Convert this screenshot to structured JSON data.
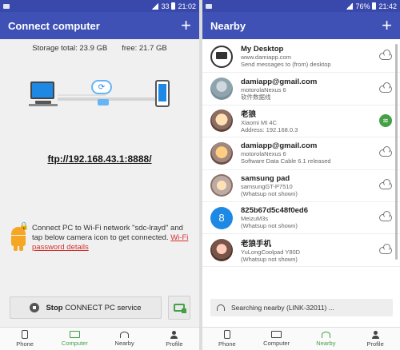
{
  "left": {
    "status": {
      "signal": "33",
      "time": "21:02"
    },
    "title": "Connect computer",
    "storage_total": "Storage total: 23.9 GB",
    "storage_free": "free: 21.7 GB",
    "ftp_address": "ftp://192.168.43.1:8888/",
    "instruction": "Connect PC to Wi-Fi network \"sdc-lrayd\" and tap below camera icon to get connected.",
    "instruction_link": "Wi-Fi password details",
    "stop_prefix": "Stop",
    "stop_label": "CONNECT PC service",
    "nav": [
      {
        "label": "Phone",
        "icon": "phone-icon"
      },
      {
        "label": "Computer",
        "icon": "computer-icon",
        "active": true
      },
      {
        "label": "Nearby",
        "icon": "nearby-icon"
      },
      {
        "label": "Profile",
        "icon": "profile-icon"
      }
    ]
  },
  "right": {
    "status": {
      "battery": "76%",
      "time": "21:42"
    },
    "title": "Nearby",
    "devices": [
      {
        "name": "My Desktop",
        "sub1": "www.damiapp.com",
        "sub2": "Send messages to (from) desktop",
        "avatar": "desktop",
        "status": "cloud"
      },
      {
        "name": "damiapp@gmail.com",
        "sub1": "motorolaNexus 6",
        "sub2": "软件数据线",
        "avatar": "photo1",
        "status": "cloud"
      },
      {
        "name": "老狼",
        "sub1": "Xiaomi MI 4C",
        "sub2": "Address: 192.168.0.3",
        "avatar": "photo2",
        "status": "wifi"
      },
      {
        "name": "damiapp@gmail.com",
        "sub1": "motorolaNexus 6",
        "sub2": "Software Data Cable 6.1 released",
        "avatar": "photo3",
        "status": "cloud"
      },
      {
        "name": "samsung pad",
        "sub1": "samsungGT-P7510",
        "sub2": "(Whatsup not shown)",
        "avatar": "photo4",
        "status": "cloud"
      },
      {
        "name": "825b67d5c48f0ed6",
        "sub1": "MeizuM3s",
        "sub2": "(Whatsup not shown)",
        "avatar": "blue",
        "avatar_text": "8",
        "status": "cloud"
      },
      {
        "name": "老狼手机",
        "sub1": "YuLongCoolpad Y80D",
        "sub2": "(Whatsup not shown)",
        "avatar": "photo5",
        "status": "cloud"
      }
    ],
    "searching": "Searching nearby (LINK-32011) ...",
    "nav": [
      {
        "label": "Phone",
        "icon": "phone-icon"
      },
      {
        "label": "Computer",
        "icon": "computer-icon"
      },
      {
        "label": "Nearby",
        "icon": "nearby-icon",
        "active": true
      },
      {
        "label": "Profile",
        "icon": "profile-icon"
      }
    ]
  },
  "colors": {
    "appbar": "#3f51b5",
    "statusbar": "#3949ab",
    "active_nav": "#43a047",
    "link": "#d32f2f"
  }
}
